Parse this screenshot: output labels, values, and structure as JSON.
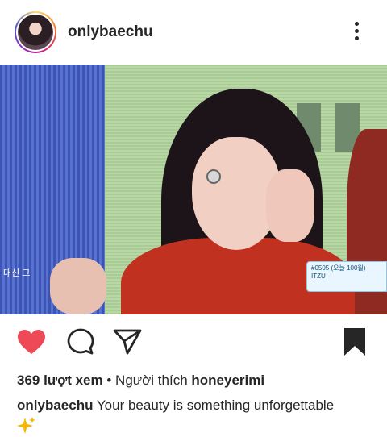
{
  "post": {
    "username": "onlybaechu",
    "views_count": "369 lượt xem",
    "separator": "•",
    "liked_by_prefix": "Người thích",
    "liked_by_user": "honeyerimi",
    "caption_user": "onlybaechu",
    "caption_text": "Your beauty is something unforgettable",
    "caption_emoji_icon": "sparkles-icon"
  },
  "photo": {
    "overlay_text_left": "대신 그",
    "badge_line1": "#0505 (오늘 100월)",
    "badge_line2": "ITZU"
  },
  "icons": {
    "like": "heart-filled-icon",
    "comment": "comment-bubble-icon",
    "share": "paper-plane-icon",
    "save": "bookmark-filled-icon",
    "more": "more-vertical-icon"
  },
  "colors": {
    "like_red": "#ed4956",
    "text": "#262626"
  }
}
